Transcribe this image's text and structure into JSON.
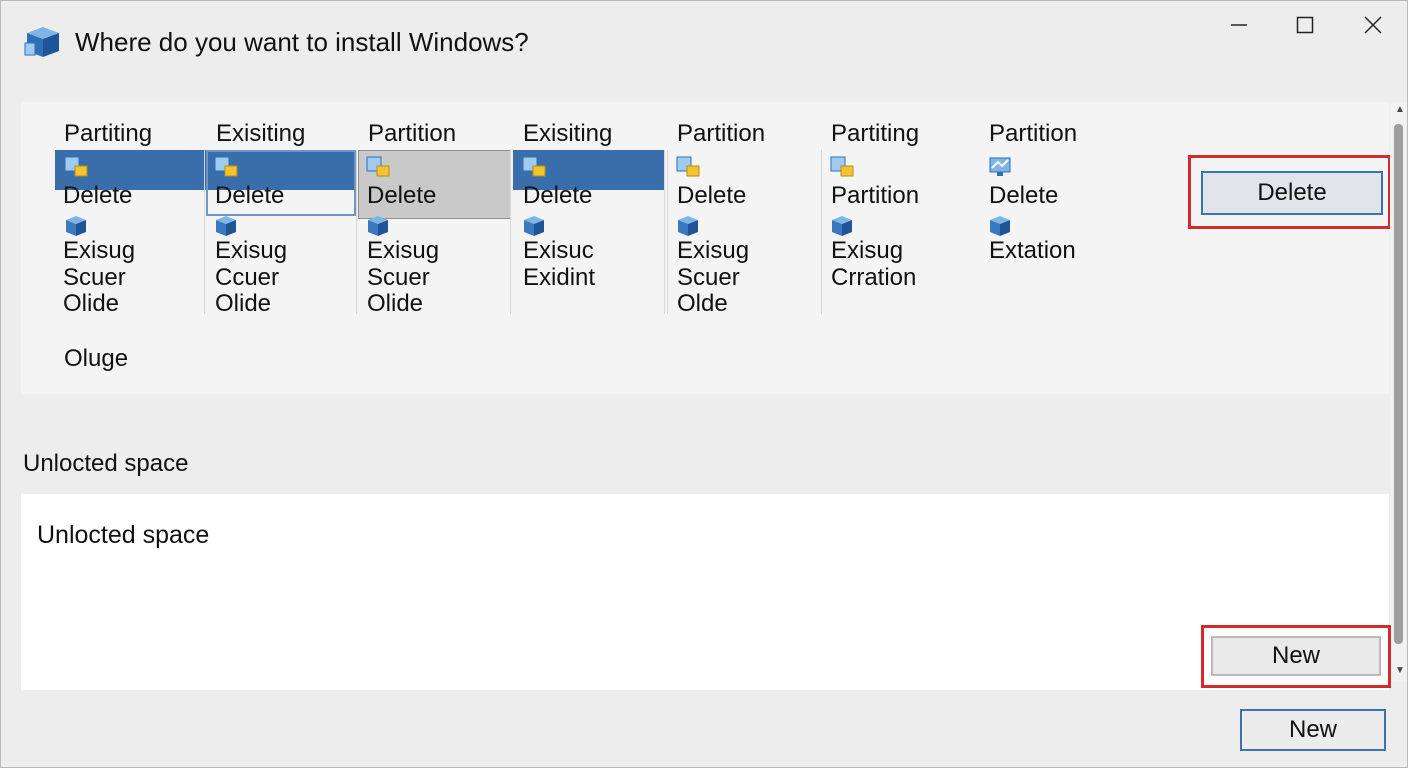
{
  "window": {
    "title": "Where do you want to install Windows?"
  },
  "partitions": [
    {
      "header": "Partiting",
      "line1": "Delete",
      "line2": "Exisug",
      "line3": "Scuer",
      "line4": "Olide",
      "state": "selected-blue"
    },
    {
      "header": "Exisiting",
      "line1": "Delete",
      "line2": "Exisug",
      "line3": "Ccuer",
      "line4": "Olide",
      "state": "selected-outline"
    },
    {
      "header": "Partition",
      "line1": "Delete",
      "line2": "Exisug",
      "line3": "Scuer",
      "line4": "Olide",
      "state": "selected-grey"
    },
    {
      "header": "Exisiting",
      "line1": "Delete",
      "line2": "Exisuc",
      "line3": "Exidint",
      "line4": "",
      "state": "selected-blue"
    },
    {
      "header": "Partition",
      "line1": "Delete",
      "line2": "Exisug",
      "line3": "Scuer",
      "line4": "Olde",
      "state": "none"
    },
    {
      "header": "Partiting",
      "line1": "Partition",
      "line2": "Exisug",
      "line3": "Crration",
      "line4": "",
      "state": "none"
    },
    {
      "header": "Partition",
      "line1": "Delete",
      "line2": "Extation",
      "line3": "",
      "line4": "",
      "state": "none"
    }
  ],
  "partition_panel": {
    "extra_label": "Oluge",
    "delete_button": "Delete"
  },
  "unallocated": {
    "section_label": "Unlocted space",
    "panel_text": "Unlocted space",
    "new_button": "New"
  },
  "footer": {
    "new_button": "New"
  },
  "colors": {
    "selection_blue": "#3a6eaa",
    "highlight_red": "#d32b2b",
    "button_border": "#3d73ad"
  }
}
